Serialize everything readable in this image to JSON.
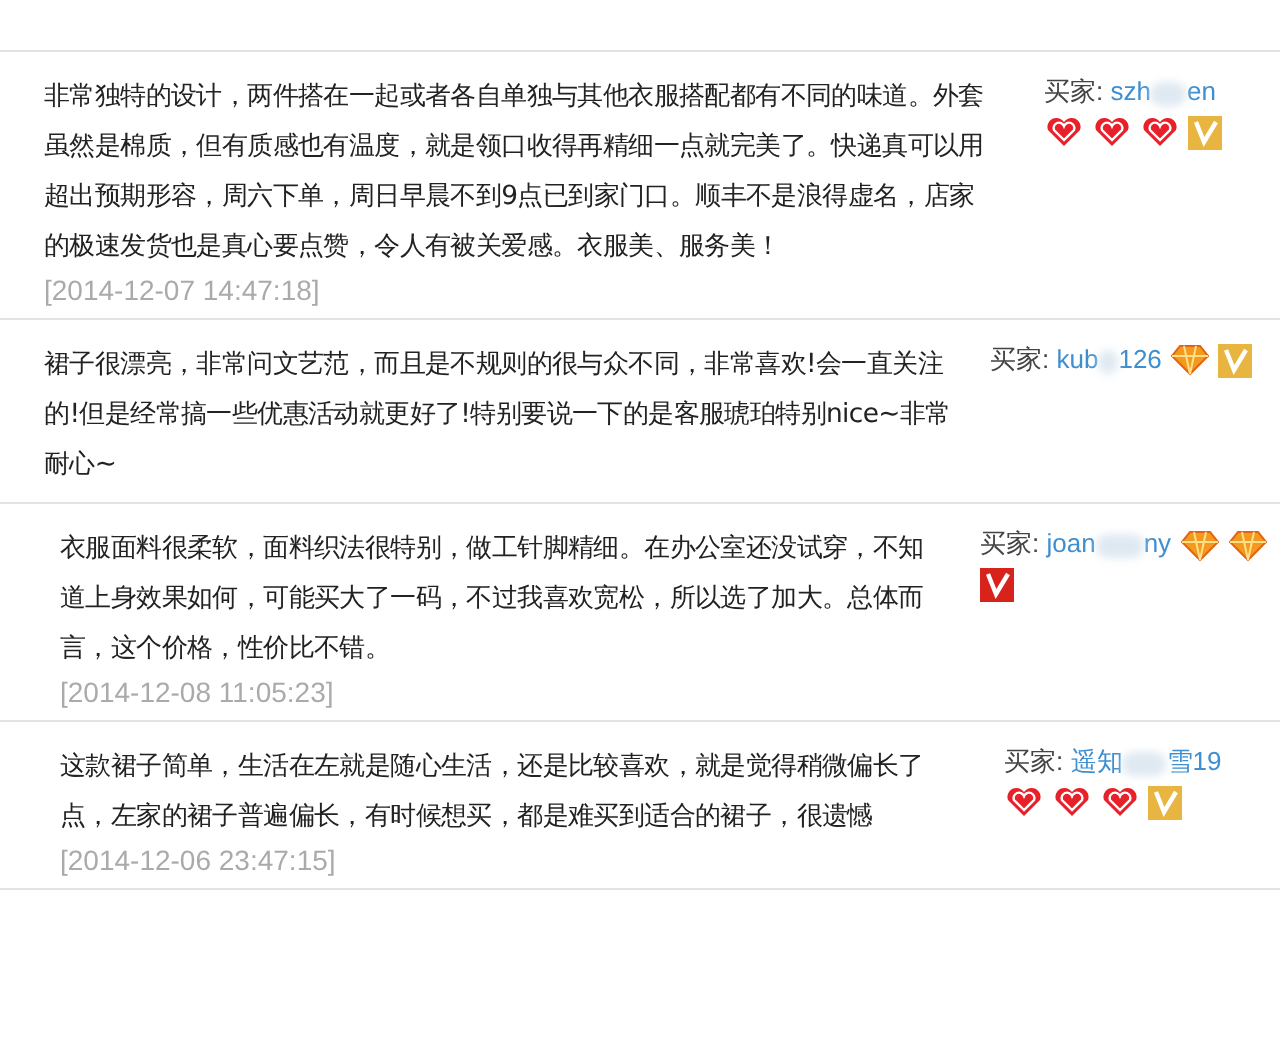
{
  "reviews": [
    {
      "text": "非常独特的设计，两件搭在一起或者各自单独与其他衣服搭配都有不同的味道。外套虽然是棉质，但有质感也有温度，就是领口收得再精细一点就完美了。快递真可以用超出预期形容，周六下单，周日早晨不到9点已到家门口。顺丰不是浪得虚名，店家的极速发货也是真心要点赞，令人有被关爱感。衣服美、服务美！",
      "date": "[2014-12-07 14:47:18]",
      "buyer_label": "买家:",
      "name_parts": [
        "szh",
        "en"
      ],
      "badges": [
        {
          "kind": "heart"
        },
        {
          "kind": "heart"
        },
        {
          "kind": "heart"
        },
        {
          "kind": "vip_gold"
        }
      ]
    },
    {
      "text": "裙子很漂亮，非常问文艺范，而且是不规则的很与众不同，非常喜欢!会一直关注的!但是经常搞一些优惠活动就更好了!特别要说一下的是客服琥珀特别nice~非常耐心~",
      "buyer_label": "买家:",
      "name_parts": [
        "kub",
        "126"
      ],
      "badges": [
        {
          "kind": "diamond"
        },
        {
          "kind": "vip_gold"
        }
      ]
    },
    {
      "text": "衣服面料很柔软，面料织法很特别，做工针脚精细。在办公室还没试穿，不知道上身效果如何，可能买大了一码，不过我喜欢宽松，所以选了加大。总体而言，这个价格，性价比不错。",
      "date": "[2014-12-08 11:05:23]",
      "buyer_label": "买家:",
      "name_parts": [
        "joan",
        "ny"
      ],
      "badges": [
        {
          "kind": "diamond"
        },
        {
          "kind": "diamond"
        },
        {
          "kind": "vip_red"
        }
      ]
    },
    {
      "text": "这款裙子简单，生活在左就是随心生活，还是比较喜欢，就是觉得稍微偏长了点，左家的裙子普遍偏长，有时候想买，都是难买到适合的裙子，很遗憾",
      "date": "[2014-12-06 23:47:15]",
      "buyer_label": "买家:",
      "name_parts": [
        "遥知",
        "雪19"
      ],
      "badges": [
        {
          "kind": "heart"
        },
        {
          "kind": "heart"
        },
        {
          "kind": "heart"
        },
        {
          "kind": "vip_gold"
        }
      ]
    }
  ]
}
